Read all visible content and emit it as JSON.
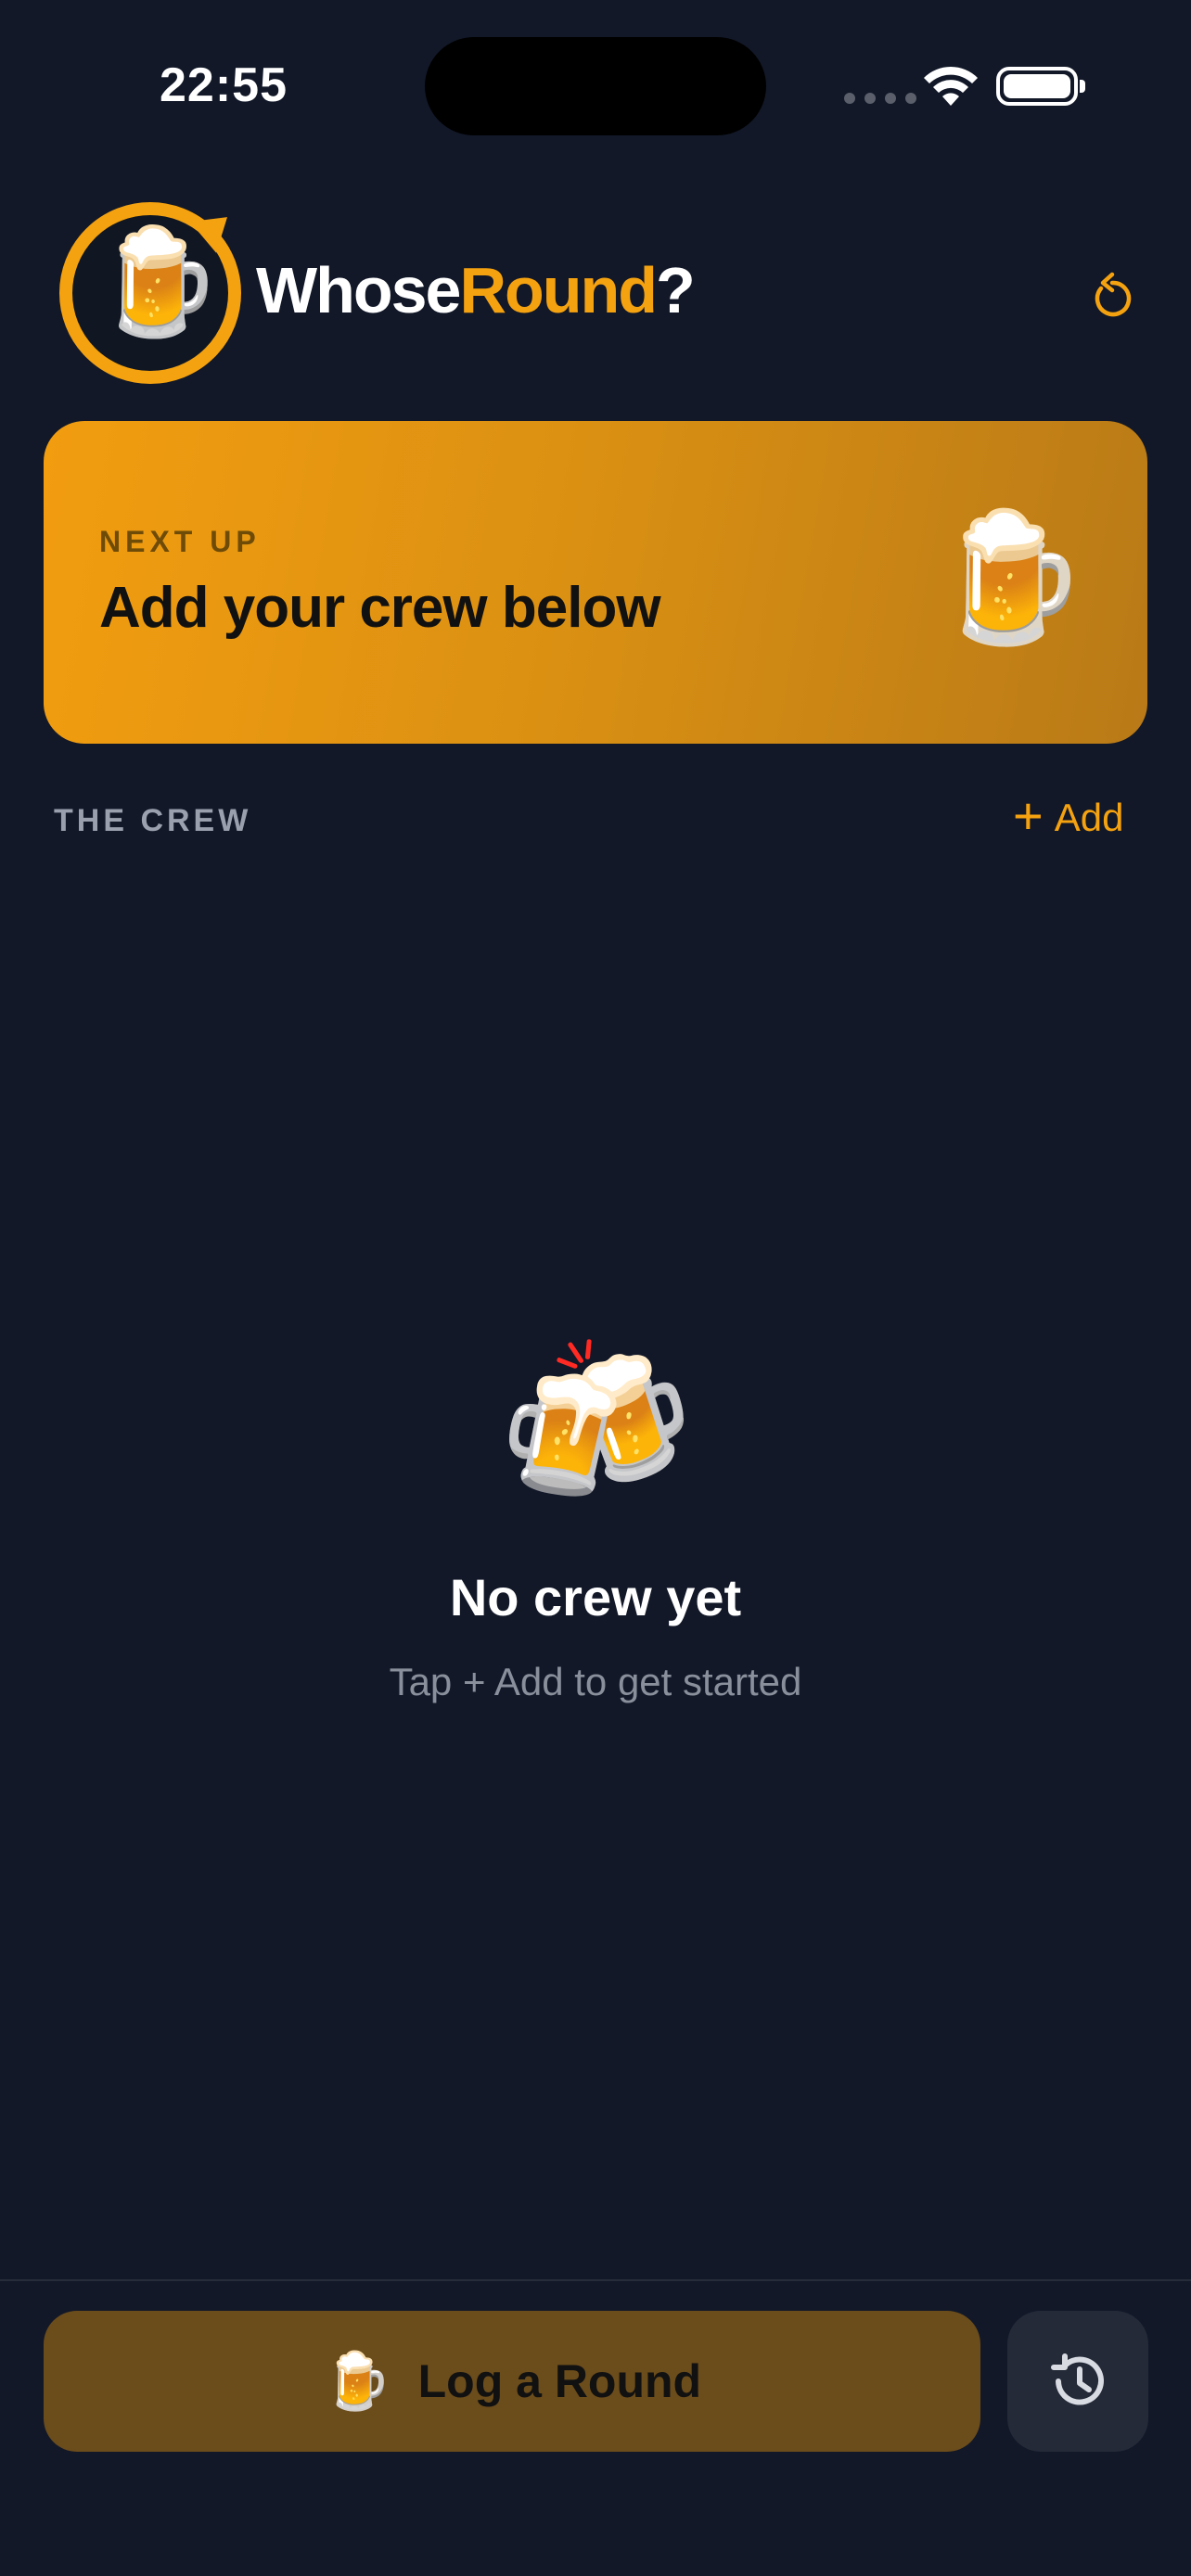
{
  "status_bar": {
    "time": "22:55"
  },
  "header": {
    "brand_part1": "Whose",
    "brand_part2": "Round",
    "brand_part3": "?",
    "logo_emoji": "🍺",
    "reset_icon": "rotate-ccw-icon"
  },
  "next_up": {
    "eyebrow": "NEXT UP",
    "title": "Add your crew below",
    "emoji": "🍺"
  },
  "crew": {
    "label": "THE CREW",
    "add_plus": "+",
    "add_label": "Add"
  },
  "empty_state": {
    "emoji": "🍻",
    "title": "No crew yet",
    "subtitle": "Tap + Add to get started"
  },
  "bottom_bar": {
    "log_emoji": "🍺",
    "log_label": "Log a Round",
    "history_icon": "history-icon"
  },
  "colors": {
    "background": "#121828",
    "accent": "#f5a210",
    "log_button": "#6b4c1b",
    "history_button": "#242a38",
    "muted_text": "#8a8f9c"
  }
}
